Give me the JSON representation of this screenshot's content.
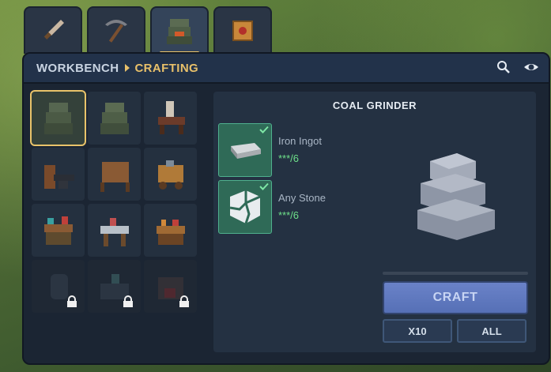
{
  "tabs": [
    {
      "icon": "knife-icon"
    },
    {
      "icon": "pickaxe-icon"
    },
    {
      "icon": "workbench-icon",
      "active": true
    },
    {
      "icon": "crate-icon"
    }
  ],
  "breadcrumb": {
    "root": "WORKBENCH",
    "current": "CRAFTING"
  },
  "header_icons": [
    "search-icon",
    "eye-icon"
  ],
  "recipes": [
    {
      "name": "coal-grinder",
      "selected": true,
      "locked": false
    },
    {
      "name": "grinder-variant",
      "locked": false
    },
    {
      "name": "skeleton-bench",
      "locked": false
    },
    {
      "name": "anvil-station",
      "locked": false
    },
    {
      "name": "hide-rack",
      "locked": false
    },
    {
      "name": "cart-station",
      "locked": false
    },
    {
      "name": "alchemy-table",
      "locked": false
    },
    {
      "name": "sewing-table",
      "locked": false
    },
    {
      "name": "tool-bench",
      "locked": false
    },
    {
      "name": "barrel-station",
      "locked": true
    },
    {
      "name": "lab-station",
      "locked": true
    },
    {
      "name": "forge-station",
      "locked": true
    }
  ],
  "detail": {
    "title": "COAL GRINDER",
    "ingredients": [
      {
        "name": "Iron Ingot",
        "qty": "***/6",
        "icon": "iron-ingot-icon",
        "met": true
      },
      {
        "name": "Any Stone",
        "qty": "***/6",
        "icon": "stone-icon",
        "met": true
      }
    ],
    "craft_label": "CRAFT",
    "x10_label": "X10",
    "all_label": "ALL"
  },
  "colors": {
    "accent": "#e8c06a",
    "craft": "#6a82c8",
    "success": "#6ee08a"
  }
}
